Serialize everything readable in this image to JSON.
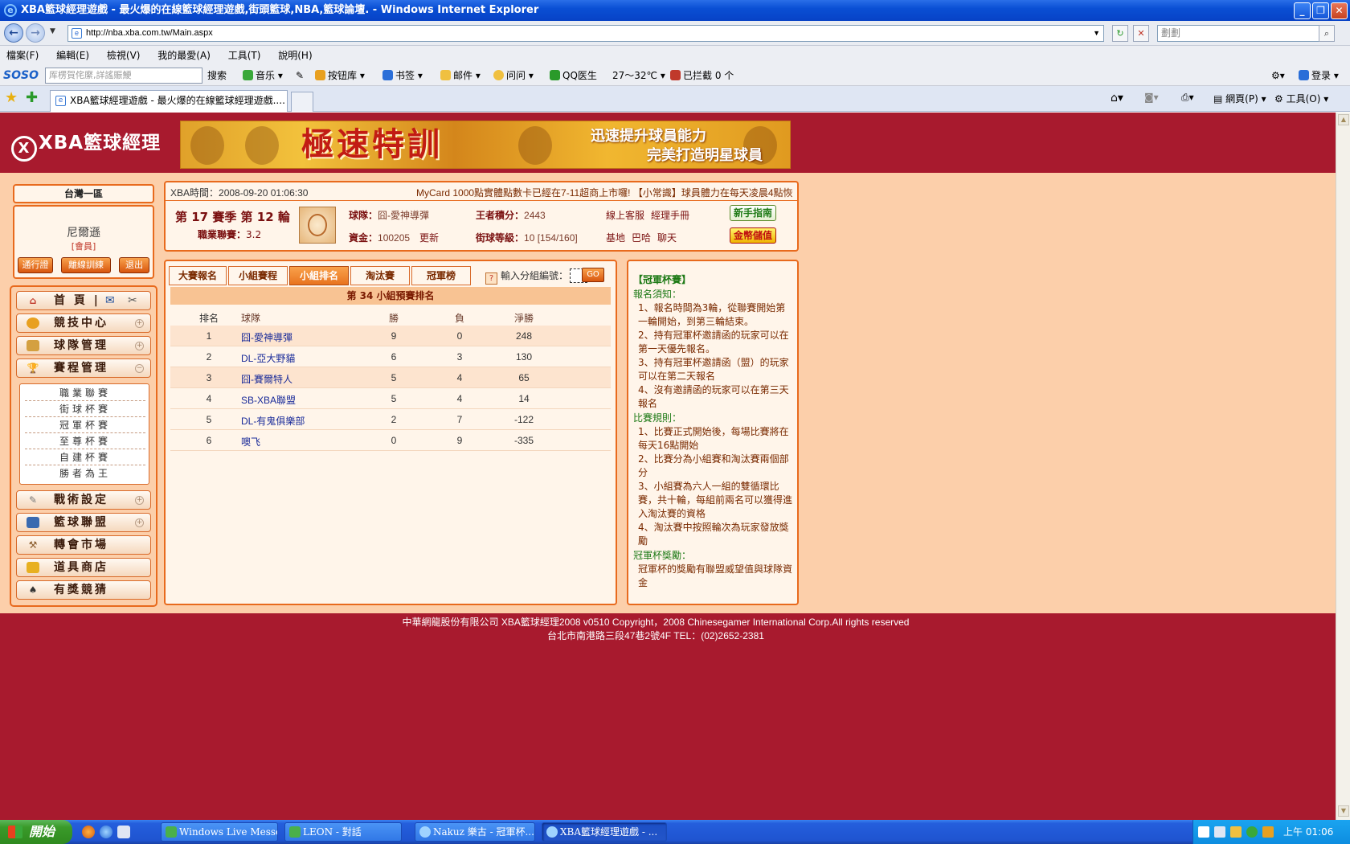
{
  "window": {
    "title": "XBA籃球經理遊戲 - 最火爆的在線籃球經理遊戲,街頭籃球,NBA,籃球論壇. - Windows Internet Explorer"
  },
  "browser": {
    "url": "http://nba.xba.com.tw/Main.aspx",
    "search_placeholder": "劃劃",
    "menu": [
      "檔案(F)",
      "編輯(E)",
      "檢視(V)",
      "我的最愛(A)",
      "工具(T)",
      "說明(H)"
    ],
    "soso": {
      "logo": "SOSO",
      "search_text": "厍楞賀侘縻,詳謠賑鯁",
      "search_btn": "搜索",
      "music": "音乐",
      "buttons_lib": "按钮库",
      "bookmark": "书签",
      "mail": "邮件",
      "ask": "问问",
      "qq_doctor": "QQ医生",
      "weather": "27～32℃",
      "blocked": "已拦截 0 个",
      "login": "登录"
    },
    "tab_title": "XBA籃球經理遊戲 - 最火爆的在線籃球經理遊戲....",
    "cmd_page": "網頁(P)",
    "cmd_tools": "工具(O)"
  },
  "site": {
    "logo_text": "XBA籃球經理",
    "banner": {
      "title": "極速特訓",
      "line1": "迅速提升球員能力",
      "line2": "完美打造明星球員"
    },
    "server": "台灣一區",
    "user": {
      "name": "尼爾遜",
      "role": "[會員]",
      "btn_pass": "通行證",
      "btn_offline": "離線訓練",
      "btn_exit": "退出"
    },
    "nav": [
      {
        "label": "首 頁 |"
      },
      {
        "label": "競技中心"
      },
      {
        "label": "球隊管理"
      },
      {
        "label": "賽程管理"
      },
      {
        "label": "戰術設定"
      },
      {
        "label": "籃球聯盟"
      },
      {
        "label": "轉會市場"
      },
      {
        "label": "道具商店"
      },
      {
        "label": "有獎競猜"
      }
    ],
    "submenu": [
      "職業聯賽",
      "街球杯賽",
      "冠軍杯賽",
      "至尊杯賽",
      "自建杯賽",
      "勝者為王"
    ],
    "info": {
      "time_label": "XBA時間：",
      "time_value": "2008-09-20 01:06:30",
      "marquee": "MyCard 1000點實體點數卡已經在7-11超商上市囉! 【小常識】球員體力在每天凌晨4點恢",
      "season": "第 17 賽季 第 12 輪",
      "pro_label": "職業聯賽：",
      "pro_value": "3.2",
      "team_label": "球隊：",
      "team_value": "囧-愛神導彈",
      "king_label": "王者積分：",
      "king_value": "2443",
      "funds_label": "資金：",
      "funds_value": "100205",
      "refresh": "更新",
      "streetball_label": "街球等級：",
      "streetball_value": "10 [154/160]",
      "online_service": "線上客服",
      "manager_handbook": "經理手冊",
      "base": "基地",
      "bar": "巴哈",
      "chat": "聊天",
      "guide_btn": "新手指南",
      "deposit_btn": "金幣儲值"
    },
    "tabs": [
      "大賽報名",
      "小組賽程",
      "小組排名",
      "淘汰賽",
      "冠軍榜"
    ],
    "group_input_label": "輸入分組編號：",
    "go_btn": "GO",
    "table": {
      "title": "第 34 小組預賽排名",
      "headers": [
        "排名",
        "球隊",
        "勝",
        "負",
        "淨勝"
      ],
      "rows": [
        {
          "rank": "1",
          "team": "囧-愛神導彈",
          "w": "9",
          "l": "0",
          "net": "248"
        },
        {
          "rank": "2",
          "team": "DL-亞大野貓",
          "w": "6",
          "l": "3",
          "net": "130"
        },
        {
          "rank": "3",
          "team": "囧-賽爾特人",
          "w": "5",
          "l": "4",
          "net": "65"
        },
        {
          "rank": "4",
          "team": "SB-XBA聯盟",
          "w": "5",
          "l": "4",
          "net": "14"
        },
        {
          "rank": "5",
          "team": "DL-有鬼俱樂部",
          "w": "2",
          "l": "7",
          "net": "-122"
        },
        {
          "rank": "6",
          "team": "噢飞",
          "w": "0",
          "l": "9",
          "net": "-335"
        }
      ]
    },
    "rules": {
      "title": "【冠軍杯賽】",
      "reg_head": "報名須知：",
      "reg": [
        "1、報名時間為3輪，從聯賽開始第一輪開始，到第三輪結束。",
        "2、持有冠軍杯邀請函的玩家可以在第一天優先報名。",
        "3、持有冠軍杯邀請函（盟）的玩家可以在第二天報名",
        "4、沒有邀請函的玩家可以在第三天報名"
      ],
      "rule_head": "比賽規則：",
      "rule": [
        "1、比賽正式開始後，每場比賽將在每天16點開始",
        "2、比賽分為小組賽和淘汰賽兩個部分",
        "3、小組賽為六人一組的雙循環比賽，共十輪，每組前兩名可以獲得進入淘汰賽的資格",
        "4、淘汰賽中按照輪次為玩家發放獎勵"
      ],
      "reward_head": "冠軍杯獎勵：",
      "reward": "冠軍杯的獎勵有聯盟威望值與球隊資金"
    },
    "footer1": "中華網龍股份有限公司 XBA籃球經理2008 v0510     Copyright，2008 Chinesegamer International Corp.All rights reserved",
    "footer2": "台北市南港路三段47巷2號4F TEL：(02)2652-2381"
  },
  "taskbar": {
    "start": "開始",
    "tasks": [
      "Windows Live Messen...",
      "LEON - 對話",
      "Nakuz 樂古 - 冠軍杯...",
      "XBA籃球經理遊戲 - ..."
    ],
    "clock": "上午 01:06"
  },
  "colors": {
    "page_bg": "#a81a2e",
    "content_bg": "#fccfaa",
    "accent_orange": "#e86a1d",
    "green_text": "#1e7a16",
    "link_blue": "#1a2b99"
  }
}
